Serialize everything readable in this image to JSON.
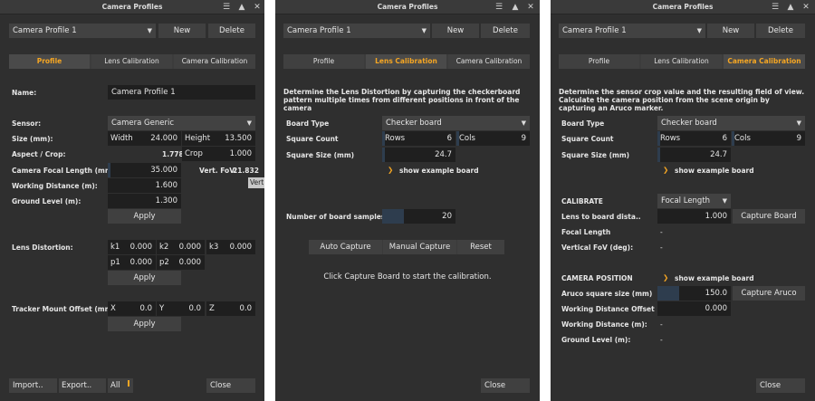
{
  "window_title": "Camera Profiles",
  "profile_selector": {
    "value": "Camera Profile 1",
    "new_label": "New",
    "delete_label": "Delete"
  },
  "tabs": {
    "profile": "Profile",
    "lens": "Lens Calibration",
    "camera": "Camera Calibration"
  },
  "close_label": "Close",
  "p1": {
    "name_label": "Name:",
    "name_value": "Camera Profile 1",
    "sensor_label": "Sensor:",
    "sensor_value": "Camera Generic",
    "size_label": "Size (mm):",
    "width_label": "Width",
    "width_value": "24.000",
    "height_label": "Height",
    "height_value": "13.500",
    "aspect_label": "Aspect / Crop:",
    "aspect_value": "1.778",
    "crop_label": "Crop",
    "crop_value": "1.000",
    "focal_label": "Camera Focal Length (mm):",
    "focal_value": "35.000",
    "vfov_label": "Vert. FoV:",
    "vfov_value": "21.832",
    "vert_tooltip": "Vert",
    "wd_label": "Working Distance (m):",
    "wd_value": "1.600",
    "gl_label": "Ground Level (m):",
    "gl_value": "1.300",
    "apply1": "Apply",
    "ld_label": "Lens Distortion:",
    "k1_label": "k1",
    "k1_value": "0.000",
    "k2_label": "k2",
    "k2_value": "0.000",
    "k3_label": "k3",
    "k3_value": "0.000",
    "p1_label": "p1",
    "p1_value": "0.000",
    "p2_label": "p2",
    "p2_value": "0.000",
    "apply2": "Apply",
    "tracker_label": "Tracker Mount Offset (mm):",
    "x_label": "X",
    "x_value": "0.0",
    "y_label": "Y",
    "y_value": "0.0",
    "z_label": "Z",
    "z_value": "0.0",
    "apply3": "Apply",
    "import_label": "Import..",
    "export_label": "Export..",
    "all_label": "All"
  },
  "p2": {
    "description": "Determine the Lens Distortion by capturing the checkerboard pattern multiple times from different positions in front of the camera",
    "board_type_label": "Board Type",
    "board_type_value": "Checker board",
    "square_count_label": "Square Count",
    "rows_label": "Rows",
    "rows_value": "6",
    "cols_label": "Cols",
    "cols_value": "9",
    "square_size_label": "Square Size (mm)",
    "square_size_value": "24.7",
    "show_example": "show example board",
    "samples_label": "Number of board samples",
    "samples_value": "20",
    "auto_capture": "Auto Capture",
    "manual_capture": "Manual Capture",
    "reset": "Reset",
    "status": "Click Capture Board to start the calibration."
  },
  "p3": {
    "description": "Determine the sensor crop value and the resulting field of view. Calculate the camera position from the scene origin by capturing an Aruco marker.",
    "board_type_label": "Board Type",
    "board_type_value": "Checker board",
    "square_count_label": "Square Count",
    "rows_label": "Rows",
    "rows_value": "6",
    "cols_label": "Cols",
    "cols_value": "9",
    "square_size_label": "Square Size (mm)",
    "square_size_value": "24.7",
    "show_example": "show example board",
    "calibrate_label": "CALIBRATE",
    "calibrate_value": "Focal Length",
    "lens_dist_label": "Lens to board dista..",
    "lens_dist_value": "1.000",
    "capture_board": "Capture Board",
    "focal_label": "Focal Length",
    "focal_value": "-",
    "vfov_label": "Vertical FoV (deg):",
    "vfov_value": "-",
    "camera_position_label": "CAMERA POSITION",
    "show_example2": "show example board",
    "aruco_label": "Aruco square size (mm)",
    "aruco_value": "150.0",
    "capture_aruco": "Capture Aruco",
    "wdo_label": "Working Distance Offset (m):",
    "wdo_value": "0.000",
    "wd_label": "Working Distance (m):",
    "wd_value": "-",
    "gl_label": "Ground Level (m):",
    "gl_value": "-"
  },
  "colors": {
    "bg": "#2f2f2f",
    "accent": "#f5a623",
    "field": "#1f1f1f",
    "button": "#404040"
  },
  "icons": [
    "menu-icon",
    "arrow-up-icon",
    "close-icon",
    "dropdown-arrow-icon",
    "chevron-right-icon"
  ]
}
